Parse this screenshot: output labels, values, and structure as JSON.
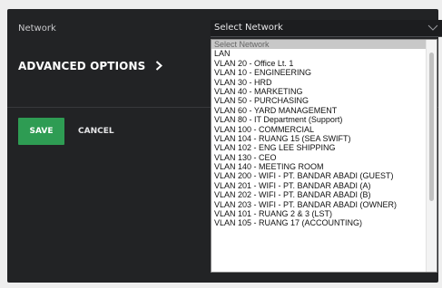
{
  "form": {
    "network_label": "Network",
    "select_value": "Select Network",
    "advanced_label": "ADVANCED OPTIONS",
    "save_label": "SAVE",
    "cancel_label": "CANCEL"
  },
  "dropdown": {
    "options": [
      "Select Network",
      "LAN",
      "VLAN 20 - Office Lt. 1",
      "VLAN 10 - ENGINEERING",
      "VLAN 30 - HRD",
      "VLAN 40 - MARKETING",
      "VLAN 50 - PURCHASING",
      "VLAN 60 - YARD MANAGEMENT",
      "VLAN 80 - IT Department (Support)",
      "VLAN 100 - COMMERCIAL",
      "VLAN 104 - RUANG 15 (SEA SWIFT)",
      "VLAN 102 - ENG LEE SHIPPING",
      "VLAN 130 - CEO",
      "VLAN 140 - MEETING ROOM",
      "VLAN 200 - WIFI - PT. BANDAR ABADI (GUEST)",
      "VLAN 201 - WIFI - PT. BANDAR ABADI (A)",
      "VLAN 202 - WIFI - PT. BANDAR ABADI (B)",
      "VLAN 203 - WIFI - PT. BANDAR ABADI (OWNER)",
      "VLAN 101 - RUANG 2 & 3 (LST)",
      "VLAN 105 - RUANG 17 (ACCOUNTING)"
    ],
    "selected_index": 0
  },
  "icons": {
    "select_caret": "chevron-down-icon",
    "advanced_chevron": "chevron-right-icon"
  },
  "colors": {
    "panel_bg": "#222325",
    "save_green": "#2e9c53",
    "selected_option_bg": "#c8c8c8"
  }
}
